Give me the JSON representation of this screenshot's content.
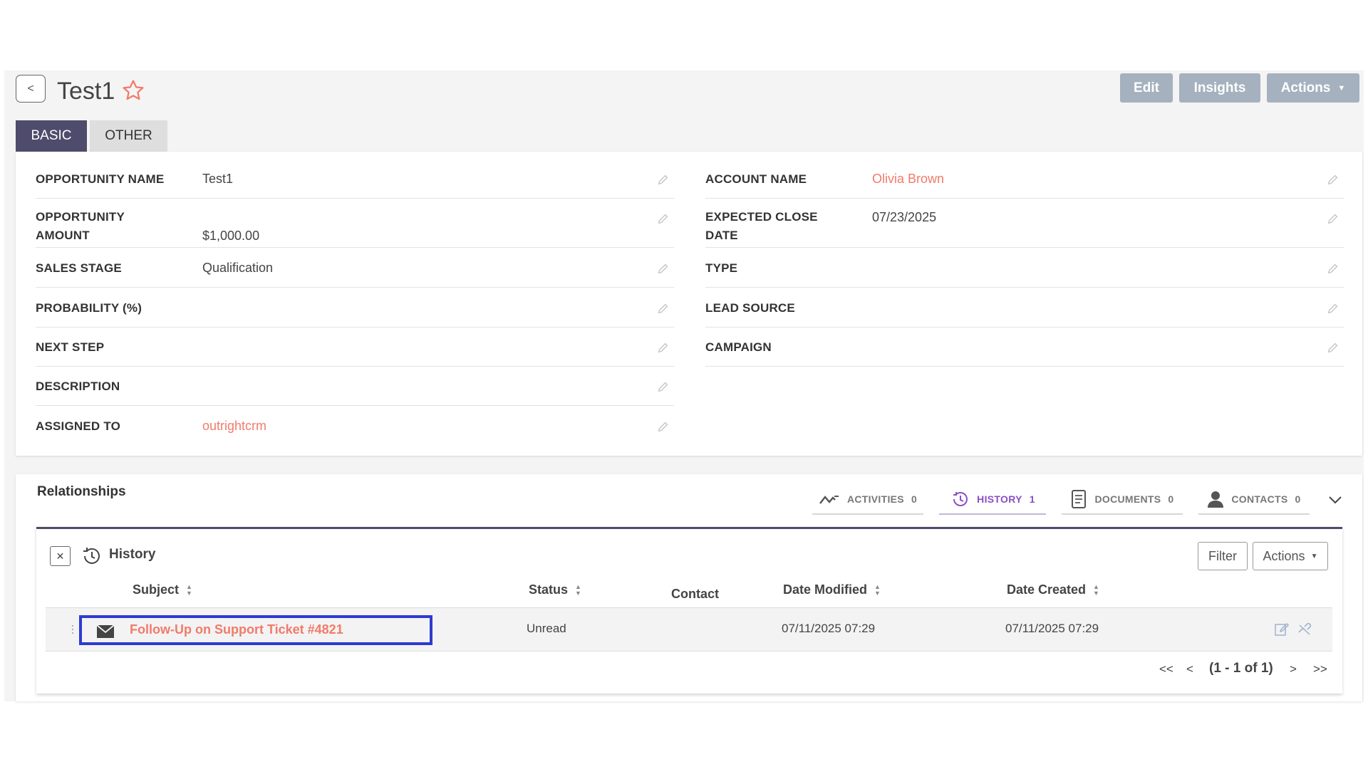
{
  "header": {
    "title": "Test1",
    "edit_label": "Edit",
    "insights_label": "Insights",
    "actions_label": "Actions"
  },
  "tabs": [
    {
      "label": "BASIC",
      "active": true
    },
    {
      "label": "OTHER",
      "active": false
    }
  ],
  "fields_left": [
    {
      "label": "OPPORTUNITY NAME",
      "value": "Test1"
    },
    {
      "label": "OPPORTUNITY AMOUNT",
      "value": "$1,000.00"
    },
    {
      "label": "SALES STAGE",
      "value": "Qualification"
    },
    {
      "label": "PROBABILITY (%)",
      "value": ""
    },
    {
      "label": "NEXT STEP",
      "value": ""
    },
    {
      "label": "DESCRIPTION",
      "value": ""
    },
    {
      "label": "ASSIGNED TO",
      "value": "outrightcrm"
    }
  ],
  "fields_right": [
    {
      "label": "ACCOUNT NAME",
      "value": "Olivia Brown"
    },
    {
      "label": "EXPECTED CLOSE DATE",
      "value": "07/23/2025"
    },
    {
      "label": "TYPE",
      "value": ""
    },
    {
      "label": "LEAD SOURCE",
      "value": ""
    },
    {
      "label": "CAMPAIGN",
      "value": ""
    }
  ],
  "relationships": {
    "title": "Relationships",
    "tabs": [
      {
        "label": "ACTIVITIES",
        "count": "0",
        "icon": "activity-line-icon"
      },
      {
        "label": "HISTORY",
        "count": "1",
        "icon": "history-icon"
      },
      {
        "label": "DOCUMENTS",
        "count": "0",
        "icon": "document-icon"
      },
      {
        "label": "CONTACTS",
        "count": "0",
        "icon": "person-icon"
      }
    ]
  },
  "history": {
    "title": "History",
    "filter_label": "Filter",
    "actions_label": "Actions",
    "columns": {
      "subject": "Subject",
      "status": "Status",
      "contact": "Contact",
      "date_modified": "Date Modified",
      "date_created": "Date Created"
    },
    "rows": [
      {
        "subject": "Follow-Up on Support Ticket #4821",
        "status": "Unread",
        "contact": "",
        "date_modified": "07/11/2025 07:29",
        "date_created": "07/11/2025 07:29"
      }
    ],
    "pagination": {
      "first": "<<",
      "prev": "<",
      "info": "(1 - 1 of 1)",
      "next": ">",
      "last": ">>"
    }
  },
  "colors": {
    "accent": "#4f4b6c",
    "link": "#f07b6b",
    "button": "#a5b1be",
    "active_tab_text": "#8a4fc4",
    "highlight_box": "#2e3bd0"
  }
}
